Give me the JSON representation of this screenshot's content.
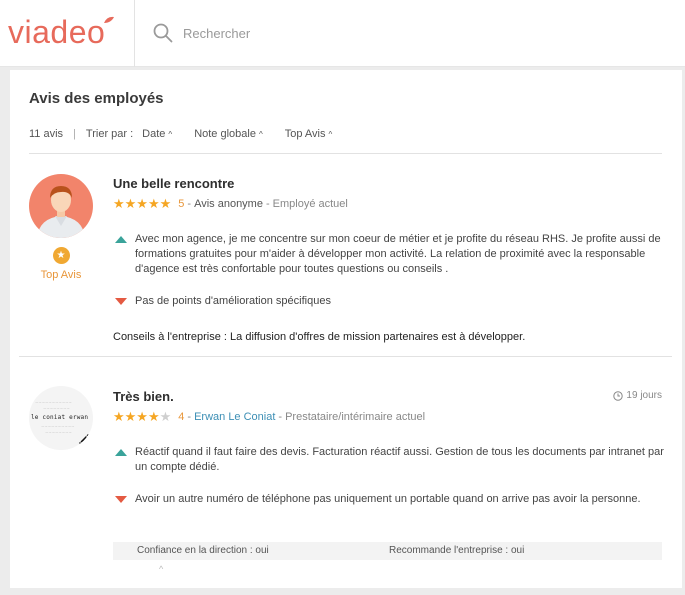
{
  "brand": {
    "logo_text": "viadeo",
    "accent": "#e76a5b"
  },
  "search": {
    "placeholder": "Rechercher",
    "value": "",
    "icon": "search-icon"
  },
  "section": {
    "title": "Avis des employés"
  },
  "filters": {
    "count": "11 avis",
    "sort_label": "Trier par :",
    "sort_options": [
      "Date",
      "Note globale",
      "Top Avis"
    ]
  },
  "reviews": [
    {
      "title": "Une belle rencontre",
      "rating": 5,
      "score_label": "5",
      "author": "Avis anonyme",
      "role": "Employé actuel",
      "badge_label": "Top Avis",
      "pros": "Avec mon agence, je me concentre sur mon coeur de métier et je profite du réseau RHS. Je profite aussi de formations gratuites pour m'aider à développer mon activité. La relation de proximité avec la responsable d'agence est très confortable pour toutes questions ou conseils .",
      "cons": "Pas de points d'amélioration spécifiques",
      "advice": "Conseils à l'entreprise : La diffusion d'offres de mission partenaires est à développer."
    },
    {
      "title": "Très bien.",
      "rating": 4,
      "score_label": "4",
      "author": "Erwan Le Coniat",
      "role": "Prestataire/intérimaire actuel",
      "time": "19 jours",
      "logo_text": "le coniat erwan",
      "pros": "Réactif quand il faut faire des devis. Facturation réactif aussi. Gestion de tous les documents par intranet par un compte dédié.",
      "cons": "Avoir un autre numéro de téléphone pas uniquement un portable quand on arrive pas avoir la personne.",
      "confidence": "Confiance en la direction : oui",
      "recommend": "Recommande l'entreprise : oui"
    }
  ],
  "colors": {
    "star": "#f5a623",
    "pro": "#3aa39a",
    "con": "#e45a42",
    "top_badge": "#f0a832",
    "link": "#3d8fb5"
  }
}
